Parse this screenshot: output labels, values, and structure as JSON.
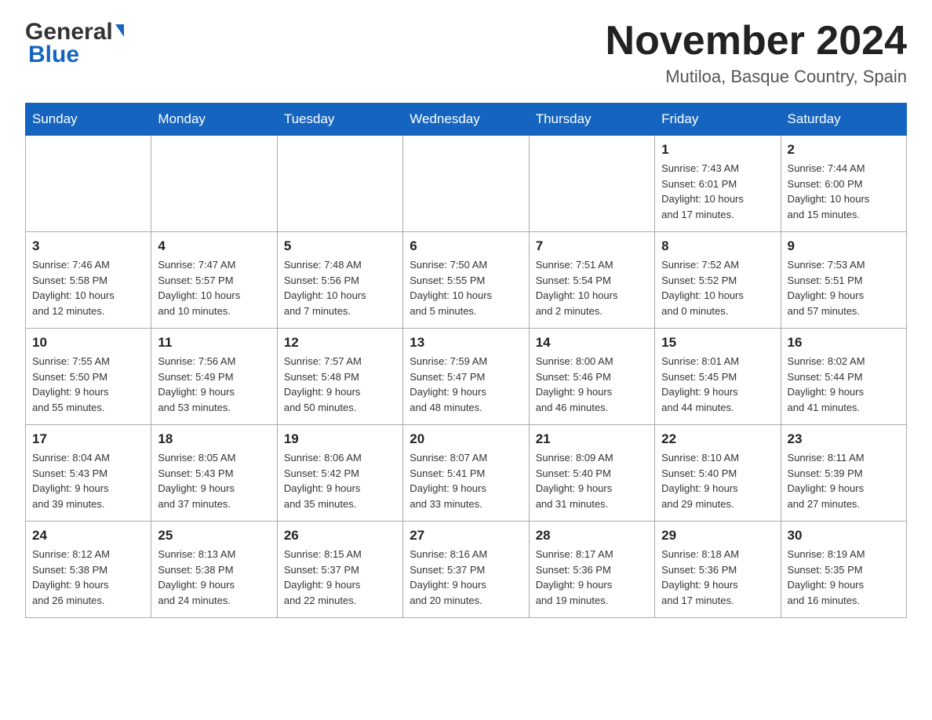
{
  "header": {
    "logo_general": "General",
    "logo_blue": "Blue",
    "month_title": "November 2024",
    "location": "Mutiloa, Basque Country, Spain"
  },
  "calendar": {
    "days_of_week": [
      "Sunday",
      "Monday",
      "Tuesday",
      "Wednesday",
      "Thursday",
      "Friday",
      "Saturday"
    ],
    "weeks": [
      [
        {
          "day": "",
          "info": ""
        },
        {
          "day": "",
          "info": ""
        },
        {
          "day": "",
          "info": ""
        },
        {
          "day": "",
          "info": ""
        },
        {
          "day": "",
          "info": ""
        },
        {
          "day": "1",
          "info": "Sunrise: 7:43 AM\nSunset: 6:01 PM\nDaylight: 10 hours\nand 17 minutes."
        },
        {
          "day": "2",
          "info": "Sunrise: 7:44 AM\nSunset: 6:00 PM\nDaylight: 10 hours\nand 15 minutes."
        }
      ],
      [
        {
          "day": "3",
          "info": "Sunrise: 7:46 AM\nSunset: 5:58 PM\nDaylight: 10 hours\nand 12 minutes."
        },
        {
          "day": "4",
          "info": "Sunrise: 7:47 AM\nSunset: 5:57 PM\nDaylight: 10 hours\nand 10 minutes."
        },
        {
          "day": "5",
          "info": "Sunrise: 7:48 AM\nSunset: 5:56 PM\nDaylight: 10 hours\nand 7 minutes."
        },
        {
          "day": "6",
          "info": "Sunrise: 7:50 AM\nSunset: 5:55 PM\nDaylight: 10 hours\nand 5 minutes."
        },
        {
          "day": "7",
          "info": "Sunrise: 7:51 AM\nSunset: 5:54 PM\nDaylight: 10 hours\nand 2 minutes."
        },
        {
          "day": "8",
          "info": "Sunrise: 7:52 AM\nSunset: 5:52 PM\nDaylight: 10 hours\nand 0 minutes."
        },
        {
          "day": "9",
          "info": "Sunrise: 7:53 AM\nSunset: 5:51 PM\nDaylight: 9 hours\nand 57 minutes."
        }
      ],
      [
        {
          "day": "10",
          "info": "Sunrise: 7:55 AM\nSunset: 5:50 PM\nDaylight: 9 hours\nand 55 minutes."
        },
        {
          "day": "11",
          "info": "Sunrise: 7:56 AM\nSunset: 5:49 PM\nDaylight: 9 hours\nand 53 minutes."
        },
        {
          "day": "12",
          "info": "Sunrise: 7:57 AM\nSunset: 5:48 PM\nDaylight: 9 hours\nand 50 minutes."
        },
        {
          "day": "13",
          "info": "Sunrise: 7:59 AM\nSunset: 5:47 PM\nDaylight: 9 hours\nand 48 minutes."
        },
        {
          "day": "14",
          "info": "Sunrise: 8:00 AM\nSunset: 5:46 PM\nDaylight: 9 hours\nand 46 minutes."
        },
        {
          "day": "15",
          "info": "Sunrise: 8:01 AM\nSunset: 5:45 PM\nDaylight: 9 hours\nand 44 minutes."
        },
        {
          "day": "16",
          "info": "Sunrise: 8:02 AM\nSunset: 5:44 PM\nDaylight: 9 hours\nand 41 minutes."
        }
      ],
      [
        {
          "day": "17",
          "info": "Sunrise: 8:04 AM\nSunset: 5:43 PM\nDaylight: 9 hours\nand 39 minutes."
        },
        {
          "day": "18",
          "info": "Sunrise: 8:05 AM\nSunset: 5:43 PM\nDaylight: 9 hours\nand 37 minutes."
        },
        {
          "day": "19",
          "info": "Sunrise: 8:06 AM\nSunset: 5:42 PM\nDaylight: 9 hours\nand 35 minutes."
        },
        {
          "day": "20",
          "info": "Sunrise: 8:07 AM\nSunset: 5:41 PM\nDaylight: 9 hours\nand 33 minutes."
        },
        {
          "day": "21",
          "info": "Sunrise: 8:09 AM\nSunset: 5:40 PM\nDaylight: 9 hours\nand 31 minutes."
        },
        {
          "day": "22",
          "info": "Sunrise: 8:10 AM\nSunset: 5:40 PM\nDaylight: 9 hours\nand 29 minutes."
        },
        {
          "day": "23",
          "info": "Sunrise: 8:11 AM\nSunset: 5:39 PM\nDaylight: 9 hours\nand 27 minutes."
        }
      ],
      [
        {
          "day": "24",
          "info": "Sunrise: 8:12 AM\nSunset: 5:38 PM\nDaylight: 9 hours\nand 26 minutes."
        },
        {
          "day": "25",
          "info": "Sunrise: 8:13 AM\nSunset: 5:38 PM\nDaylight: 9 hours\nand 24 minutes."
        },
        {
          "day": "26",
          "info": "Sunrise: 8:15 AM\nSunset: 5:37 PM\nDaylight: 9 hours\nand 22 minutes."
        },
        {
          "day": "27",
          "info": "Sunrise: 8:16 AM\nSunset: 5:37 PM\nDaylight: 9 hours\nand 20 minutes."
        },
        {
          "day": "28",
          "info": "Sunrise: 8:17 AM\nSunset: 5:36 PM\nDaylight: 9 hours\nand 19 minutes."
        },
        {
          "day": "29",
          "info": "Sunrise: 8:18 AM\nSunset: 5:36 PM\nDaylight: 9 hours\nand 17 minutes."
        },
        {
          "day": "30",
          "info": "Sunrise: 8:19 AM\nSunset: 5:35 PM\nDaylight: 9 hours\nand 16 minutes."
        }
      ]
    ]
  }
}
